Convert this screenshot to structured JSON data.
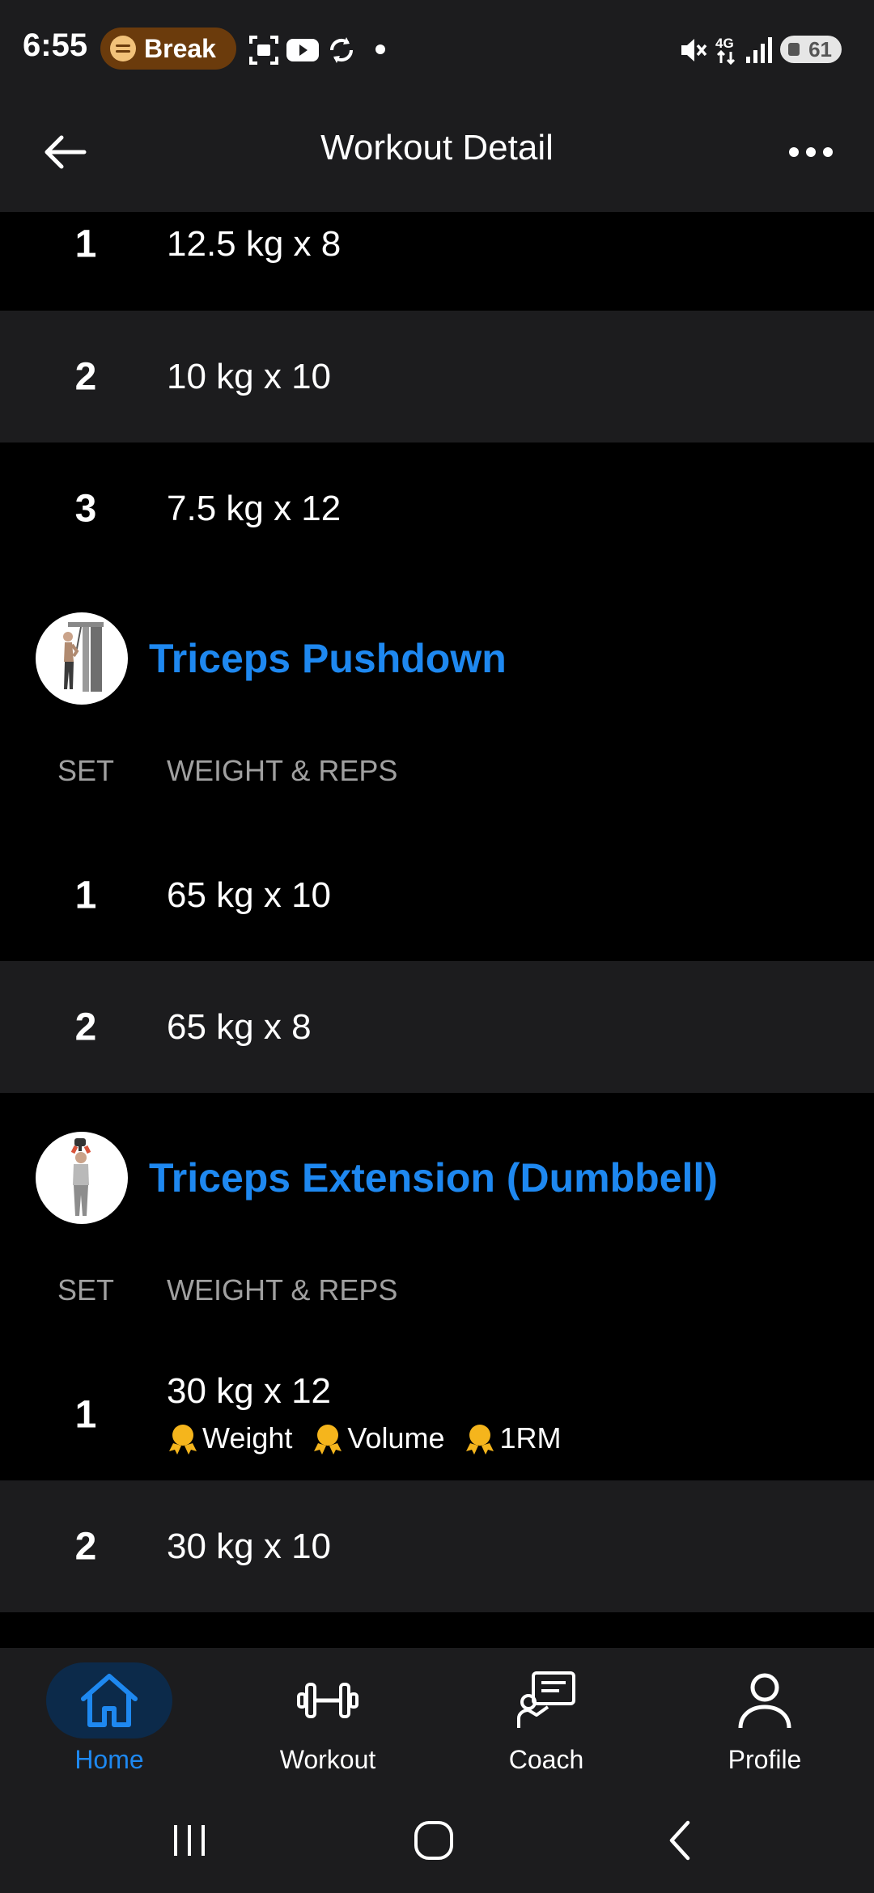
{
  "status_bar": {
    "time": "6:55",
    "media_pill": "Break",
    "battery": "61"
  },
  "header": {
    "title": "Workout Detail"
  },
  "previous_exercise": {
    "sets": [
      {
        "set": "1",
        "value": "12.5 kg x 8"
      },
      {
        "set": "2",
        "value": "10 kg x 10"
      },
      {
        "set": "3",
        "value": "7.5 kg x 12"
      }
    ]
  },
  "exercises": [
    {
      "name": "Triceps Pushdown",
      "col_set": "SET",
      "col_weight_reps": "WEIGHT & REPS",
      "sets": [
        {
          "set": "1",
          "value": "65 kg x 10"
        },
        {
          "set": "2",
          "value": "65 kg x 8"
        }
      ]
    },
    {
      "name": "Triceps Extension (Dumbbell)",
      "col_set": "SET",
      "col_weight_reps": "WEIGHT & REPS",
      "sets": [
        {
          "set": "1",
          "value": "30 kg x 12",
          "badges": [
            "Weight",
            "Volume",
            "1RM"
          ]
        },
        {
          "set": "2",
          "value": "30 kg x 10"
        }
      ]
    }
  ],
  "bottom_nav": {
    "items": [
      {
        "label": "Home",
        "active": true
      },
      {
        "label": "Workout"
      },
      {
        "label": "Coach"
      },
      {
        "label": "Profile"
      }
    ]
  },
  "colors": {
    "accent": "#1e88f0",
    "surface": "#1c1c1e",
    "background": "#000000",
    "medal": "#f5b51c"
  }
}
